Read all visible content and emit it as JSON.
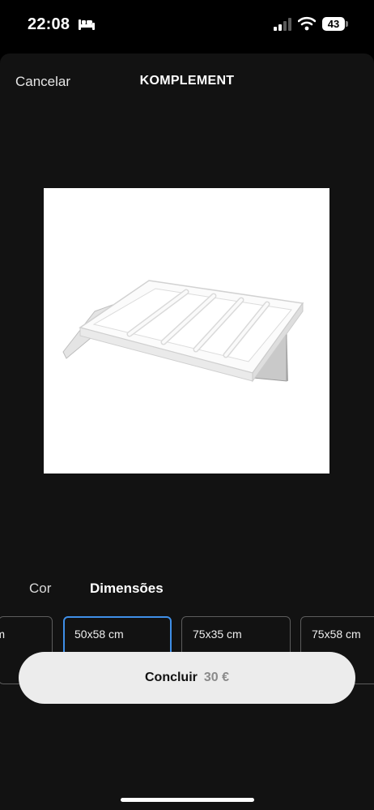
{
  "status_bar": {
    "time": "22:08",
    "battery": "43"
  },
  "header": {
    "cancel_label": "Cancelar",
    "title": "KOMPLEMENT"
  },
  "tabs": [
    {
      "label": "Cor"
    },
    {
      "label": "Dimensões",
      "selected": true
    }
  ],
  "options": [
    {
      "label": "m"
    },
    {
      "label": "50x58 cm",
      "selected": true
    },
    {
      "label": "75x35 cm"
    },
    {
      "label": "75x58 cm"
    }
  ],
  "footer": {
    "done_label": "Concluir",
    "price": "30 €"
  },
  "colors": {
    "accent": "#3f8fe8",
    "background": "#121212",
    "button": "#ececec"
  },
  "icons": [
    "bed-icon",
    "cellular-signal-icon",
    "wifi-icon",
    "battery-icon"
  ]
}
